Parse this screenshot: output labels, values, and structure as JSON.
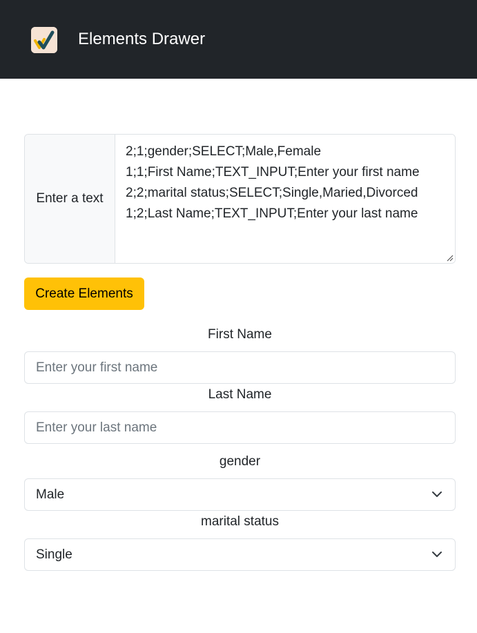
{
  "navbar": {
    "brand": "Elements Drawer",
    "logo_icon": "checkmark-logo-icon"
  },
  "input_area": {
    "label": "Enter a text",
    "lines": [
      "2;1;gender;SELECT;Male,Female",
      "1;1;First Name;TEXT_INPUT;Enter your first name",
      "2;2;marital status;SELECT;Single,Maried,Divorced",
      "1;2;Last Name;TEXT_INPUT;Enter your last name"
    ]
  },
  "create_button": {
    "label": "Create Elements",
    "color": "#ffc107"
  },
  "fields": {
    "first_name": {
      "label": "First Name",
      "placeholder": "Enter your first name"
    },
    "last_name": {
      "label": "Last Name",
      "placeholder": "Enter your last name"
    },
    "gender": {
      "label": "gender",
      "selected": "Male"
    },
    "marital_status": {
      "label": "marital status",
      "selected": "Single"
    }
  },
  "colors": {
    "navbar_bg": "#212529",
    "accent": "#ffc107"
  }
}
